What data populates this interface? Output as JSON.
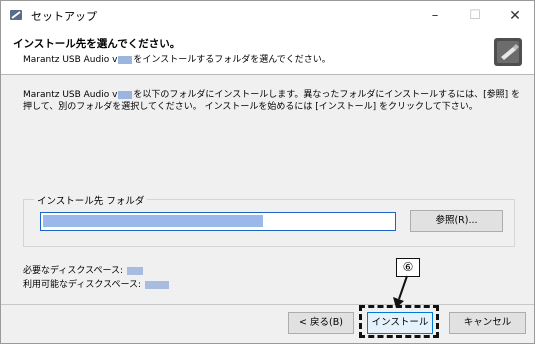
{
  "window": {
    "title": "セットアップ",
    "controls": {
      "minimize": "–",
      "maximize": "☐",
      "close": "✕"
    }
  },
  "header": {
    "title": "インストール先を選んでください。",
    "subtitle_prefix": "Marantz USB Audio v",
    "subtitle_suffix": "をインストールするフォルダを選んでください。"
  },
  "description": {
    "prefix": "Marantz USB Audio v",
    "suffix": "を以下のフォルダにインストールします。異なったフォルダにインストールするには、[参照] を押して、別のフォルダを選択してください。 インストールを始めるには [インストール] をクリックして下さい。"
  },
  "destination": {
    "legend": "インストール先 フォルダ",
    "browse_label": "参照(R)..."
  },
  "space": {
    "required_label": "必要なディスクスペース:",
    "available_label": "利用可能なディスクスペース:"
  },
  "buttons": {
    "back": "< 戻る(B)",
    "install": "インストール",
    "cancel": "キャンセル"
  },
  "annotation": {
    "step": "⑥"
  },
  "colors": {
    "accent": "#0078d7",
    "blur": "#9ab8ea"
  }
}
